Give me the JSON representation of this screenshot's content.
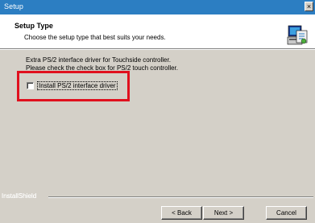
{
  "window": {
    "title": "Setup",
    "close_label": "×"
  },
  "header": {
    "title": "Setup Type",
    "subtitle": "Choose the setup type that best suits your needs.",
    "icon": "computer-setup-icon"
  },
  "body": {
    "line1": "Extra PS/2 interface driver for Touchside controller.",
    "line2": "Please check the check box for PS/2 touch controller.",
    "checkbox": {
      "label": "Install PS/2 interface driver",
      "checked": false
    }
  },
  "footer": {
    "brand": "InstallShield",
    "back_label": "< Back",
    "next_label": "Next >",
    "cancel_label": "Cancel"
  },
  "colors": {
    "titlebar": "#2c7ec2",
    "highlight": "#e0101e",
    "dialog": "#d4d0c8"
  }
}
